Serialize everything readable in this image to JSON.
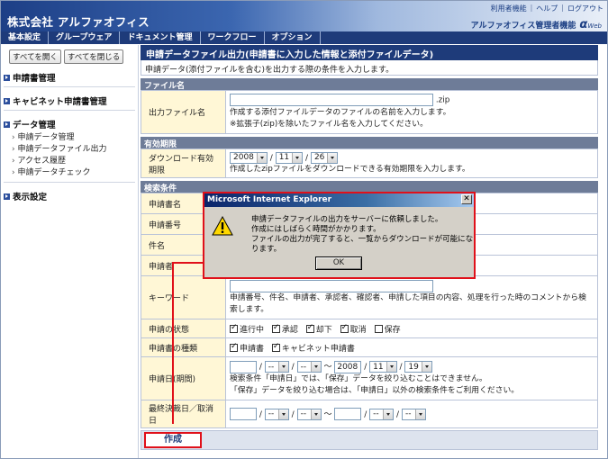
{
  "header": {
    "company": "株式会社 アルファオフィス",
    "links": [
      "利用者機能",
      "ヘルプ",
      "ログアウト"
    ],
    "brand_text": "アルファオフィス管理者機能",
    "brand_logo": "α",
    "brand_logo_small": "Web"
  },
  "menu": [
    "基本設定",
    "グループウェア",
    "ドキュメント管理",
    "ワークフロー",
    "オプション"
  ],
  "sidebar": {
    "open_all": "すべてを開く",
    "close_all": "すべてを閉じる",
    "sections": [
      {
        "label": "申請書管理",
        "items": []
      },
      {
        "label": "キャビネット申請書管理",
        "items": []
      },
      {
        "label": "データ管理",
        "items": [
          "申請データ管理",
          "申請データファイル出力",
          "アクセス履歴",
          "申請データチェック"
        ]
      },
      {
        "label": "表示設定",
        "items": []
      }
    ]
  },
  "main": {
    "title": "申請データファイル出力(申請書に入力した情報と添付ファイルデータ)",
    "description": "申請データ(添付ファイルを含む)を出力する際の条件を入力します。",
    "file_section": "ファイル名",
    "output_label": "出力ファイル名",
    "zip_ext": ".zip",
    "output_note1": "作成する添付ファイルデータのファイルの名前を入力します。",
    "output_note2": "※拡張子(zip)を除いたファイル名を入力してください。",
    "expiry_section": "有効期限",
    "download_label": "ダウンロード有効期限",
    "dl_year": "2008",
    "dl_month": "11",
    "dl_day": "26",
    "slash": "/",
    "download_note": "作成したzipファイルをダウンロードできる有効期限を入力します。",
    "search_section": "検索条件",
    "form_name_label": "申請書名",
    "form_number_label": "申請番号",
    "subject_label": "件名",
    "applicant_label": "申請者",
    "keyword_label": "キーワード",
    "keyword_note": "申請番号、件名、申請者、承認者、確認者、申請した項目の内容、処理を行った時のコメントから検索します。",
    "status_label": "申請の状態",
    "status_options": [
      "進行中",
      "承認",
      "却下",
      "取消",
      "保存"
    ],
    "type_label": "申請書の種類",
    "type_options": [
      "申請書",
      "キャビネット申請書"
    ],
    "date_label": "申請日(期間)",
    "dash": "--",
    "tilde": "～",
    "to_year": "2008",
    "to_month": "11",
    "to_day": "19",
    "date_note1": "検索条件「申請日」では、「保存」データを絞り込むことはできません。",
    "date_note2": "「保存」データを絞り込む場合は、「申請日」以外の検索条件をご利用ください。",
    "final_label": "最終決裁日／取消日",
    "create_button": "作成"
  },
  "dialog": {
    "title": "Microsoft Internet Explorer",
    "close": "✕",
    "line1": "申請データファイルの出力をサーバーに依頼しました。",
    "line2": "作成にはしばらく時間がかかります。",
    "line3": "ファイルの出力が完了すると、一覧からダウンロードが可能になります。",
    "ok": "OK"
  }
}
